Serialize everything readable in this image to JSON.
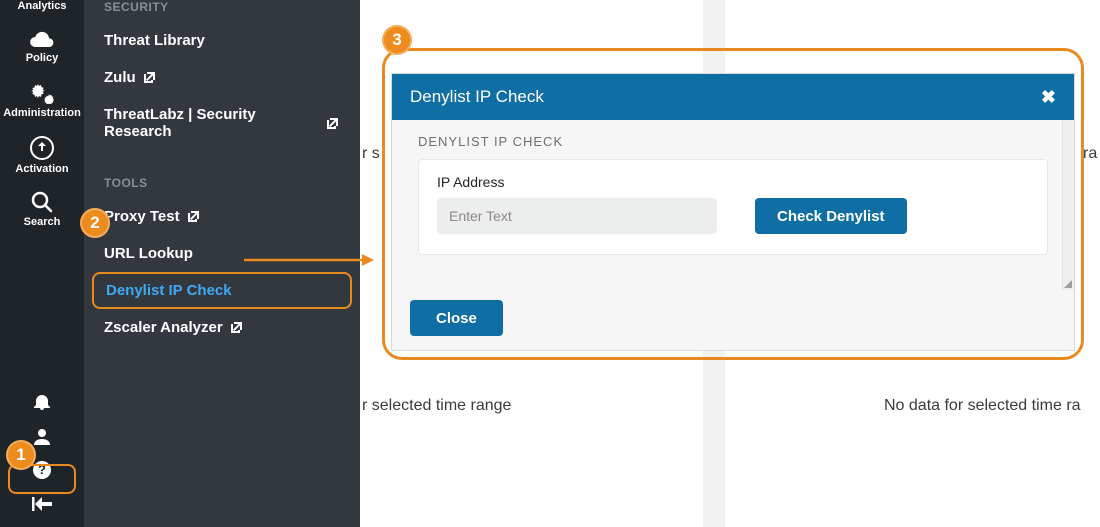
{
  "rail": {
    "items": [
      {
        "key": "analytics",
        "label": "Analytics"
      },
      {
        "key": "policy",
        "label": "Policy"
      },
      {
        "key": "administration",
        "label": "Administration"
      },
      {
        "key": "activation",
        "label": "Activation"
      },
      {
        "key": "search",
        "label": "Search"
      }
    ]
  },
  "panel": {
    "sections": [
      {
        "label": "SECURITY",
        "items": [
          {
            "label": "Threat Library",
            "external": false
          },
          {
            "label": "Zulu",
            "external": true
          },
          {
            "label": "ThreatLabz | Security Research",
            "external": true
          }
        ]
      },
      {
        "label": "TOOLS",
        "items": [
          {
            "label": "Proxy Test",
            "external": true
          },
          {
            "label": "URL Lookup",
            "external": false
          },
          {
            "label": "Denylist IP Check",
            "external": false,
            "active": true
          },
          {
            "label": "Zscaler Analyzer",
            "external": true
          }
        ]
      }
    ]
  },
  "modal": {
    "title": "Denylist IP Check",
    "section_label": "DENYLIST IP CHECK",
    "field_label": "IP Address",
    "placeholder": "Enter Text",
    "check_button": "Check Denylist",
    "close_button": "Close"
  },
  "background": {
    "left_fragment_a": "r s",
    "left_fragment_b": "r selected time range",
    "right_fragment_a": "ra",
    "right_fragment_b": "No data for selected time ra"
  },
  "callouts": {
    "one": "1",
    "two": "2",
    "three": "3"
  },
  "colors": {
    "accent": "#e88a1f",
    "brand": "#0f6ea3",
    "rail": "#1f2428",
    "panel": "#32383d"
  }
}
